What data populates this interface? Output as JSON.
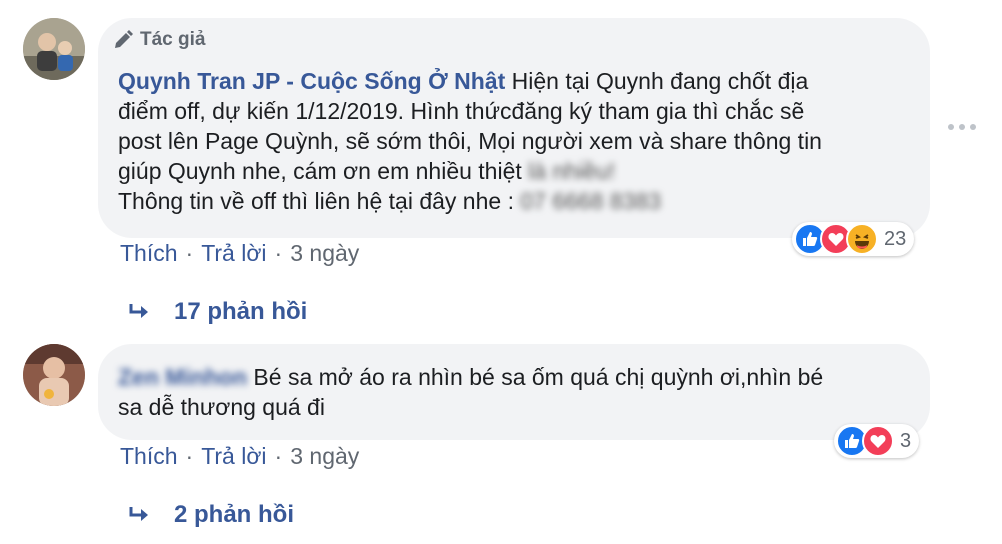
{
  "comments": [
    {
      "badge": "Tác giả",
      "author": "Quynh Tran JP - Cuộc Sống Ở Nhật",
      "text_lines": [
        "Hiện tại Quynh đang chốt địa",
        "điểm off, dự kiến 1/12/2019. Hình thứcđăng ký tham gia thì chắc sẽ",
        "post lên Page Quỳnh, sẽ sớm thôi, Mọi người xem và share thông tin",
        "giúp Quynh nhe, cám ơn em nhiều thiệt"
      ],
      "text_blurred_tail": "là nhiều!",
      "line5_text": "Thông tin về off thì liên hệ tại đây nhe :",
      "line5_blurred": "07 6668 8383",
      "actions": {
        "like": "Thích",
        "reply": "Trả lời",
        "time": "3 ngày",
        "sep": "·"
      },
      "reaction_count": "23",
      "reaction_icons": [
        "like-icon",
        "love-icon",
        "haha-icon"
      ],
      "replies_label": "17 phản hồi"
    },
    {
      "author_blurred": "Zen Minhon",
      "text_lines": [
        "Bé sa mở áo ra nhìn bé sa ốm quá chị quỳnh ơi,nhìn bé",
        "sa dễ thương quá đi"
      ],
      "actions": {
        "like": "Thích",
        "reply": "Trả lời",
        "time": "3 ngày",
        "sep": "·"
      },
      "reaction_count": "3",
      "reaction_icons": [
        "like-icon",
        "love-icon"
      ],
      "replies_label": "2 phản hồi"
    }
  ],
  "colors": {
    "link": "#385898",
    "bubble": "#f2f3f5",
    "like": "#1877f2",
    "love": "#f33e58",
    "haha": "#f7b125"
  }
}
